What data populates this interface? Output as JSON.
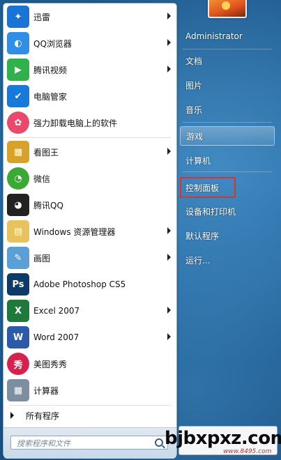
{
  "programs": [
    {
      "label": "迅雷",
      "icon": "xunlei-bird-icon",
      "color": "#1a74d6",
      "arrow": true
    },
    {
      "label": "QQ浏览器",
      "icon": "qq-browser-icon",
      "color": "#2f8fe6",
      "arrow": true
    },
    {
      "label": "腾讯视频",
      "icon": "tencent-video-icon",
      "color": "#31b14b",
      "arrow": true
    },
    {
      "label": "电脑管家",
      "icon": "shield-icon",
      "color": "#1779d9",
      "arrow": false
    },
    {
      "label": "强力卸载电脑上的软件",
      "icon": "uninstall-flower-icon",
      "color": "#e94a6b",
      "arrow": false
    },
    {
      "label": "看图王",
      "icon": "image-viewer-icon",
      "color": "#d8a12a",
      "arrow": true
    },
    {
      "label": "微信",
      "icon": "wechat-icon",
      "color": "#3aaa35",
      "arrow": false
    },
    {
      "label": "腾讯QQ",
      "icon": "qq-penguin-icon",
      "color": "#222222",
      "arrow": false
    },
    {
      "label": "Windows 资源管理器",
      "icon": "folder-icon",
      "color": "#e8c25c",
      "arrow": true
    },
    {
      "label": "画图",
      "icon": "paint-palette-icon",
      "color": "#5a9fd6",
      "arrow": true
    },
    {
      "label": "Adobe Photoshop CS5",
      "icon": "photoshop-icon",
      "color": "#0d3a66",
      "arrow": false
    },
    {
      "label": "Excel 2007",
      "icon": "excel-icon",
      "color": "#1e7a3a",
      "arrow": true
    },
    {
      "label": "Word 2007",
      "icon": "word-icon",
      "color": "#2a5aa8",
      "arrow": true
    },
    {
      "label": "美图秀秀",
      "icon": "meitu-icon",
      "color": "#d8204c",
      "arrow": false
    },
    {
      "label": "计算器",
      "icon": "calculator-icon",
      "color": "#7c8ea0",
      "arrow": false
    }
  ],
  "icon_glyphs": [
    "✦",
    "◐",
    "▶",
    "✔",
    "✿",
    "▦",
    "◔",
    "◕",
    "▤",
    "✎",
    "Ps",
    "X",
    "W",
    "秀",
    "▦"
  ],
  "all_programs": "所有程序",
  "search": {
    "placeholder": "搜索程序和文件"
  },
  "right_menu": [
    {
      "label": "Administrator"
    },
    {
      "label": "文档"
    },
    {
      "label": "图片"
    },
    {
      "label": "音乐"
    },
    {
      "label": "游戏"
    },
    {
      "label": "计算机"
    },
    {
      "label": "控制面板"
    },
    {
      "label": "设备和打印机"
    },
    {
      "label": "默认程序"
    },
    {
      "label": "运行..."
    }
  ],
  "watermark": {
    "main": "bjbxpxz.com",
    "sub": "www.8495.com"
  },
  "colors": {
    "highlight_box": "#e0302b",
    "menu_bg": "#1f5c90"
  }
}
